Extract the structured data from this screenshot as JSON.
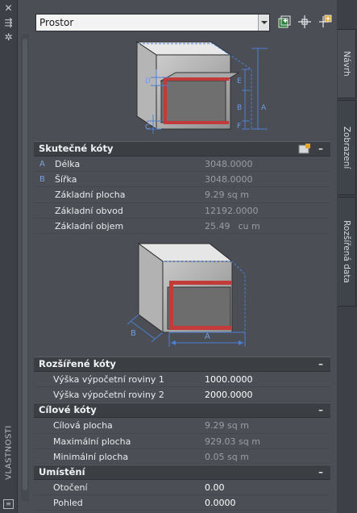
{
  "strip": {
    "close_glyph": "✕",
    "pin_glyph": "⇶",
    "settings_glyph": "✲",
    "title": "VLASTNOSTI"
  },
  "header": {
    "dropdown_value": "Prostor"
  },
  "tabs": [
    {
      "label": "Návrh",
      "active": true
    },
    {
      "label": "Zobrazení",
      "active": false
    },
    {
      "label": "Rozšířená data",
      "active": false
    }
  ],
  "diagram1": {
    "labels": [
      "D",
      "E",
      "B",
      "A",
      "C",
      "F"
    ]
  },
  "diagram2": {
    "labels": [
      "B",
      "A"
    ]
  },
  "sections": {
    "actual": {
      "title": "Skutečné kóty",
      "collapse": "–",
      "rows": [
        {
          "badge": "A",
          "label": "Délka",
          "value": "3048.0000"
        },
        {
          "badge": "B",
          "label": "Šířka",
          "value": "3048.0000"
        },
        {
          "badge": "",
          "label": "Základní plocha",
          "value": "9.29 sq m"
        },
        {
          "badge": "",
          "label": "Základní obvod",
          "value": "12192.0000"
        },
        {
          "badge": "",
          "label": "Základní objem",
          "value": "25.49",
          "unit": "cu m"
        }
      ]
    },
    "extended": {
      "title": "Rozšířené kóty",
      "collapse": "–",
      "rows": [
        {
          "label": "Výška výpočetní roviny 1",
          "value": "1000.0000"
        },
        {
          "label": "Výška výpočetní roviny 2",
          "value": "2000.0000"
        }
      ]
    },
    "target": {
      "title": "Cílové kóty",
      "collapse": "–",
      "rows": [
        {
          "label": "Cílová plocha",
          "value": "9.29 sq m"
        },
        {
          "label": "Maximální plocha",
          "value": "929.03 sq m"
        },
        {
          "label": "Minimální plocha",
          "value": "0.05 sq m"
        }
      ]
    },
    "location": {
      "title": "Umístění",
      "collapse": "–",
      "rows": [
        {
          "label": "Otočení",
          "value": "0.00"
        },
        {
          "label": "Pohled",
          "value": "0.0000"
        }
      ]
    }
  },
  "colors": {
    "panel_bg": "#4b4f55",
    "section_bg": "#3b3e43",
    "dim_blue": "#4d7fd6",
    "wall_red": "#c23a3a"
  }
}
